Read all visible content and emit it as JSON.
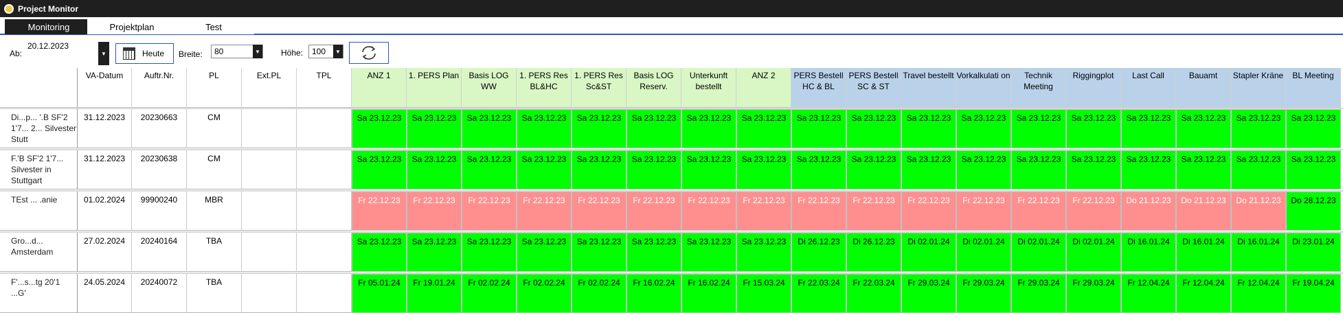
{
  "window": {
    "title": "Project Monitor"
  },
  "tabs": [
    {
      "label": "Monitoring",
      "active": true
    },
    {
      "label": "Projektplan",
      "active": false
    },
    {
      "label": "Test",
      "active": false
    }
  ],
  "toolbar": {
    "ab_label": "Ab:",
    "ab_value": "20.12.2023",
    "heute_label": "Heute",
    "breite_label": "Breite:",
    "breite_value": "80",
    "hoehe_label": "Höhe:",
    "hoehe_value": "100"
  },
  "colors": {
    "green": "#00ff00",
    "red": "#ff8f8f",
    "header_green": "#d9f7c5",
    "header_blue": "#b9d2ea",
    "accent": "#2b57b5"
  },
  "grid": {
    "info_headers": [
      "VA-Datum",
      "Auftr.Nr.",
      "PL",
      "Ext.PL",
      "TPL"
    ],
    "milestone_headers": [
      {
        "label": "ANZ 1",
        "group": "green"
      },
      {
        "label": "1. PERS Plan",
        "group": "green"
      },
      {
        "label": "Basis LOG WW",
        "group": "green"
      },
      {
        "label": "1. PERS Res BL&HC",
        "group": "green"
      },
      {
        "label": "1. PERS Res Sc&ST",
        "group": "green"
      },
      {
        "label": "Basis LOG Reserv.",
        "group": "green"
      },
      {
        "label": "Unterkunft bestellt",
        "group": "green"
      },
      {
        "label": "ANZ 2",
        "group": "green"
      },
      {
        "label": "PERS Bestell HC & BL",
        "group": "blue"
      },
      {
        "label": "PERS Bestell SC & ST",
        "group": "blue"
      },
      {
        "label": "Travel bestellt",
        "group": "blue"
      },
      {
        "label": "Vorkalkulati on",
        "group": "blue"
      },
      {
        "label": "Technik Meeting",
        "group": "blue"
      },
      {
        "label": "Riggingplot",
        "group": "blue"
      },
      {
        "label": "Last Call",
        "group": "blue"
      },
      {
        "label": "Bauamt",
        "group": "blue"
      },
      {
        "label": "Stapler Kräne",
        "group": "blue"
      },
      {
        "label": "BL Meeting",
        "group": "blue"
      }
    ],
    "rows": [
      {
        "name": "Di...p... '.B SF'2 1'7... 2... Silvester Stutt",
        "info": [
          "31.12.2023",
          "20230663",
          "CM",
          "",
          ""
        ],
        "cells": [
          {
            "t": "Sa 23.12.23",
            "s": "green"
          },
          {
            "t": "Sa 23.12.23",
            "s": "green"
          },
          {
            "t": "Sa 23.12.23",
            "s": "green"
          },
          {
            "t": "Sa 23.12.23",
            "s": "green"
          },
          {
            "t": "Sa 23.12.23",
            "s": "green"
          },
          {
            "t": "Sa 23.12.23",
            "s": "green"
          },
          {
            "t": "Sa 23.12.23",
            "s": "green"
          },
          {
            "t": "Sa 23.12.23",
            "s": "green"
          },
          {
            "t": "Sa 23.12.23",
            "s": "green"
          },
          {
            "t": "Sa 23.12.23",
            "s": "green"
          },
          {
            "t": "Sa 23.12.23",
            "s": "green"
          },
          {
            "t": "Sa 23.12.23",
            "s": "green"
          },
          {
            "t": "Sa 23.12.23",
            "s": "green"
          },
          {
            "t": "Sa 23.12.23",
            "s": "green"
          },
          {
            "t": "Sa 23.12.23",
            "s": "green"
          },
          {
            "t": "Sa 23.12.23",
            "s": "green"
          },
          {
            "t": "Sa 23.12.23",
            "s": "green"
          },
          {
            "t": "Sa 23.12.23",
            "s": "green"
          }
        ]
      },
      {
        "name": "F.'B SF'2 1'7... Silvester in Stuttgart",
        "info": [
          "31.12.2023",
          "20230638",
          "CM",
          "",
          ""
        ],
        "cells": [
          {
            "t": "Sa 23.12.23",
            "s": "green"
          },
          {
            "t": "Sa 23.12.23",
            "s": "green"
          },
          {
            "t": "Sa 23.12.23",
            "s": "green"
          },
          {
            "t": "Sa 23.12.23",
            "s": "green"
          },
          {
            "t": "Sa 23.12.23",
            "s": "green"
          },
          {
            "t": "Sa 23.12.23",
            "s": "green"
          },
          {
            "t": "Sa 23.12.23",
            "s": "green"
          },
          {
            "t": "Sa 23.12.23",
            "s": "green"
          },
          {
            "t": "Sa 23.12.23",
            "s": "green"
          },
          {
            "t": "Sa 23.12.23",
            "s": "green"
          },
          {
            "t": "Sa 23.12.23",
            "s": "green"
          },
          {
            "t": "Sa 23.12.23",
            "s": "green"
          },
          {
            "t": "Sa 23.12.23",
            "s": "green"
          },
          {
            "t": "Sa 23.12.23",
            "s": "green"
          },
          {
            "t": "Sa 23.12.23",
            "s": "green"
          },
          {
            "t": "Sa 23.12.23",
            "s": "green"
          },
          {
            "t": "Sa 23.12.23",
            "s": "green"
          },
          {
            "t": "Sa 23.12.23",
            "s": "green"
          }
        ]
      },
      {
        "name": "TEst ... .anie",
        "info": [
          "01.02.2024",
          "99900240",
          "MBR",
          "",
          ""
        ],
        "cells": [
          {
            "t": "Fr 22.12.23",
            "s": "red"
          },
          {
            "t": "Fr 22.12.23",
            "s": "red"
          },
          {
            "t": "Fr 22.12.23",
            "s": "red"
          },
          {
            "t": "Fr 22.12.23",
            "s": "red"
          },
          {
            "t": "Fr 22.12.23",
            "s": "red"
          },
          {
            "t": "Fr 22.12.23",
            "s": "red"
          },
          {
            "t": "Fr 22.12.23",
            "s": "red"
          },
          {
            "t": "Fr 22.12.23",
            "s": "red"
          },
          {
            "t": "Fr 22.12.23",
            "s": "red"
          },
          {
            "t": "Fr 22.12.23",
            "s": "red"
          },
          {
            "t": "Fr 22.12.23",
            "s": "red"
          },
          {
            "t": "Fr 22.12.23",
            "s": "red"
          },
          {
            "t": "Fr 22.12.23",
            "s": "red"
          },
          {
            "t": "Fr 22.12.23",
            "s": "red"
          },
          {
            "t": "Do 21.12.23",
            "s": "red"
          },
          {
            "t": "Do 21.12.23",
            "s": "red"
          },
          {
            "t": "Do 21.12.23",
            "s": "red"
          },
          {
            "t": "Do 28.12.23",
            "s": "green"
          }
        ]
      },
      {
        "name": "Gro...d... Amsterdam",
        "info": [
          "27.02.2024",
          "20240164",
          "TBA",
          "",
          ""
        ],
        "cells": [
          {
            "t": "Sa 23.12.23",
            "s": "green"
          },
          {
            "t": "Sa 23.12.23",
            "s": "green"
          },
          {
            "t": "Sa 23.12.23",
            "s": "green"
          },
          {
            "t": "Sa 23.12.23",
            "s": "green"
          },
          {
            "t": "Sa 23.12.23",
            "s": "green"
          },
          {
            "t": "Sa 23.12.23",
            "s": "green"
          },
          {
            "t": "Sa 23.12.23",
            "s": "green"
          },
          {
            "t": "Sa 23.12.23",
            "s": "green"
          },
          {
            "t": "Di 26.12.23",
            "s": "green"
          },
          {
            "t": "Di 26.12.23",
            "s": "green"
          },
          {
            "t": "Di 02.01.24",
            "s": "green"
          },
          {
            "t": "Di 02.01.24",
            "s": "green"
          },
          {
            "t": "Di 02.01.24",
            "s": "green"
          },
          {
            "t": "Di 02.01.24",
            "s": "green"
          },
          {
            "t": "Di 16.01.24",
            "s": "green"
          },
          {
            "t": "Di 16.01.24",
            "s": "green"
          },
          {
            "t": "Di 16.01.24",
            "s": "green"
          },
          {
            "t": "Di 23.01.24",
            "s": "green"
          }
        ]
      },
      {
        "name": "F'...s...tg 20'1 ...G'",
        "info": [
          "24.05.2024",
          "20240072",
          "TBA",
          "",
          ""
        ],
        "cells": [
          {
            "t": "Fr 05.01.24",
            "s": "green"
          },
          {
            "t": "Fr 19.01.24",
            "s": "green"
          },
          {
            "t": "Fr 02.02.24",
            "s": "green"
          },
          {
            "t": "Fr 02.02.24",
            "s": "green"
          },
          {
            "t": "Fr 02.02.24",
            "s": "green"
          },
          {
            "t": "Fr 16.02.24",
            "s": "green"
          },
          {
            "t": "Fr 16.02.24",
            "s": "green"
          },
          {
            "t": "Fr 15.03.24",
            "s": "green"
          },
          {
            "t": "Fr 22.03.24",
            "s": "green"
          },
          {
            "t": "Fr 22.03.24",
            "s": "green"
          },
          {
            "t": "Fr 29.03.24",
            "s": "green"
          },
          {
            "t": "Fr 29.03.24",
            "s": "green"
          },
          {
            "t": "Fr 29.03.24",
            "s": "green"
          },
          {
            "t": "Fr 29.03.24",
            "s": "green"
          },
          {
            "t": "Fr 12.04.24",
            "s": "green"
          },
          {
            "t": "Fr 12.04.24",
            "s": "green"
          },
          {
            "t": "Fr 12.04.24",
            "s": "green"
          },
          {
            "t": "Fr 19.04.24",
            "s": "green"
          }
        ]
      }
    ]
  }
}
